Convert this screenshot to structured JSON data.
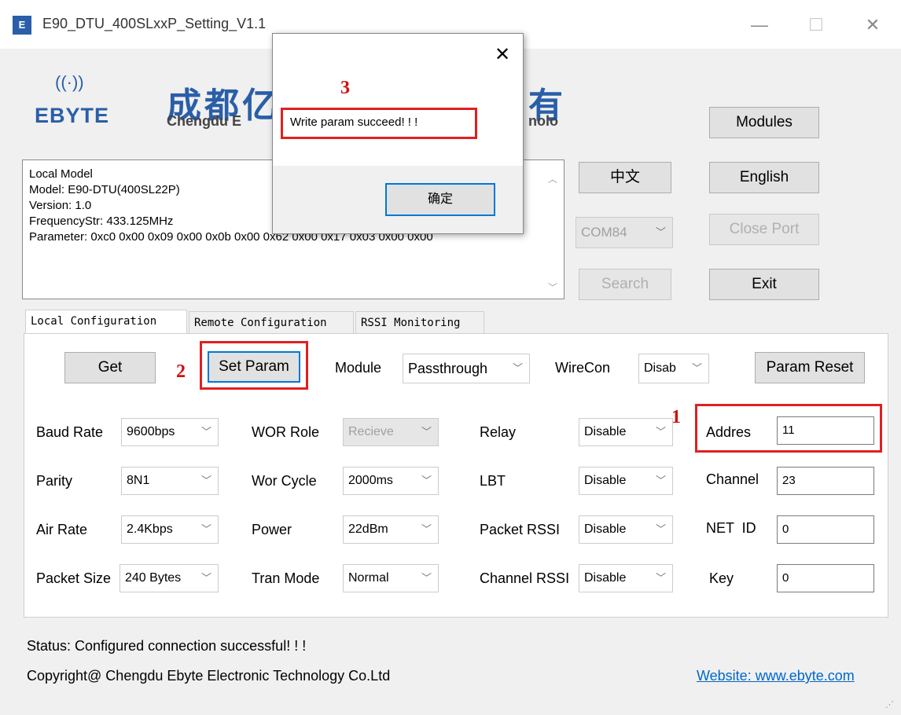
{
  "window": {
    "title": "E90_DTU_400SLxxP_Setting_V1.1",
    "icon_text": "E",
    "minimize": "—",
    "maximize": "☐",
    "close": "✕"
  },
  "logo": {
    "waves": "((·))",
    "brand": "EBYTE",
    "company_cn_a": "成都亿",
    "company_cn_b": "有",
    "company_en_a": "Chengdu E",
    "company_en_b": "nolo"
  },
  "buttons": {
    "modules": "Modules",
    "chinese": "中文",
    "english": "English",
    "close_port": "Close Port",
    "search": "Search",
    "exit": "Exit"
  },
  "port": {
    "value": "COM84"
  },
  "info": {
    "lines": [
      "Local Model",
      "Model: E90-DTU(400SL22P)",
      "Version: 1.0",
      "FrequencyStr: 433.125MHz",
      "Parameter:  0xc0 0x00 0x09 0x00 0x0b 0x00 0x62 0x00 0x17 0x03 0x00 0x00"
    ]
  },
  "tabs": [
    "Local Configuration",
    "Remote Configuration",
    "RSSI Monitoring"
  ],
  "toolbar": {
    "get": "Get",
    "set_param": "Set Param",
    "module_label": "Module",
    "module_value": "Passthrough",
    "wirecon_label": "WireCon",
    "wirecon_value": "Disab",
    "param_reset": "Param Reset"
  },
  "params": {
    "baud_rate": {
      "label": "Baud Rate",
      "value": "9600bps"
    },
    "parity": {
      "label": "Parity",
      "value": "8N1"
    },
    "air_rate": {
      "label": "Air Rate",
      "value": "2.4Kbps"
    },
    "packet_size": {
      "label": "Packet Size",
      "value": "240 Bytes"
    },
    "wor_role": {
      "label": "WOR Role",
      "value": "Recieve"
    },
    "wor_cycle": {
      "label": "Wor Cycle",
      "value": "2000ms"
    },
    "power": {
      "label": "Power",
      "value": "22dBm"
    },
    "tran_mode": {
      "label": "Tran Mode",
      "value": "Normal"
    },
    "relay": {
      "label": "Relay",
      "value": "Disable"
    },
    "lbt": {
      "label": "LBT",
      "value": "Disable"
    },
    "packet_rssi": {
      "label": "Packet RSSI",
      "value": "Disable"
    },
    "channel_rssi": {
      "label": "Channel RSSI",
      "value": "Disable"
    },
    "address": {
      "label": "Addres",
      "value": "11"
    },
    "channel": {
      "label": "Channel",
      "value": "23"
    },
    "net_id": {
      "label": "NET  ID",
      "value": "0"
    },
    "key": {
      "label": "Key",
      "value": "0"
    }
  },
  "annotations": {
    "n1": "1",
    "n2": "2",
    "n3": "3"
  },
  "dialog": {
    "message": "Write param succeed! ! !",
    "ok": "确定",
    "close": "✕"
  },
  "status": "Status: Configured connection successful! ! !",
  "copyright": "Copyright@ Chengdu Ebyte Electronic Technology Co.Ltd",
  "website": "Website: www.ebyte.com",
  "colors": {
    "brand_blue": "#2a5ea8",
    "annotation_red": "#e02020",
    "focus_blue": "#0078d7",
    "link": "#0066cc"
  }
}
